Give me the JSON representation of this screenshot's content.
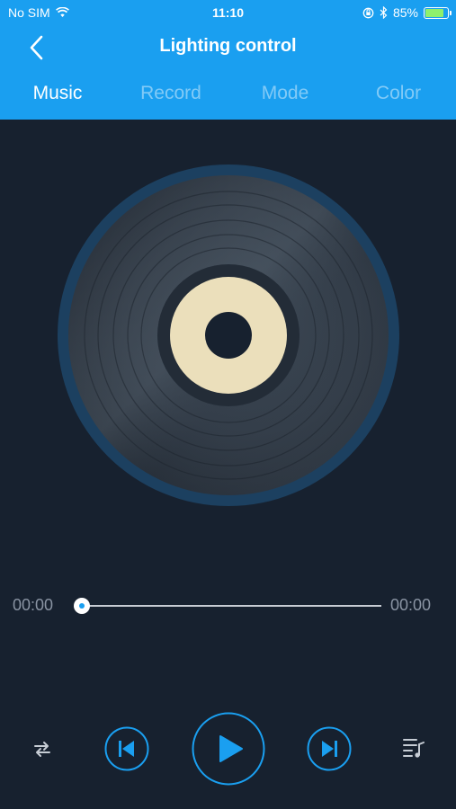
{
  "status_bar": {
    "carrier": "No SIM",
    "time": "11:10",
    "battery_percent": "85%",
    "battery_level": 0.85
  },
  "header": {
    "title": "Lighting control",
    "tabs": [
      {
        "label": "Music",
        "active": true
      },
      {
        "label": "Record",
        "active": false
      },
      {
        "label": "Mode",
        "active": false
      },
      {
        "label": "Color",
        "active": false
      }
    ]
  },
  "player": {
    "elapsed": "00:00",
    "duration": "00:00",
    "progress": 0
  },
  "icons": {
    "back": "chevron-left-icon",
    "repeat": "repeat-icon",
    "previous": "skip-previous-icon",
    "play": "play-icon",
    "next": "skip-next-icon",
    "playlist": "playlist-icon"
  },
  "colors": {
    "header": "#1a9ff0",
    "background": "#17212f",
    "accent": "#1a9ff0",
    "label_center": "#ebdfbb"
  }
}
